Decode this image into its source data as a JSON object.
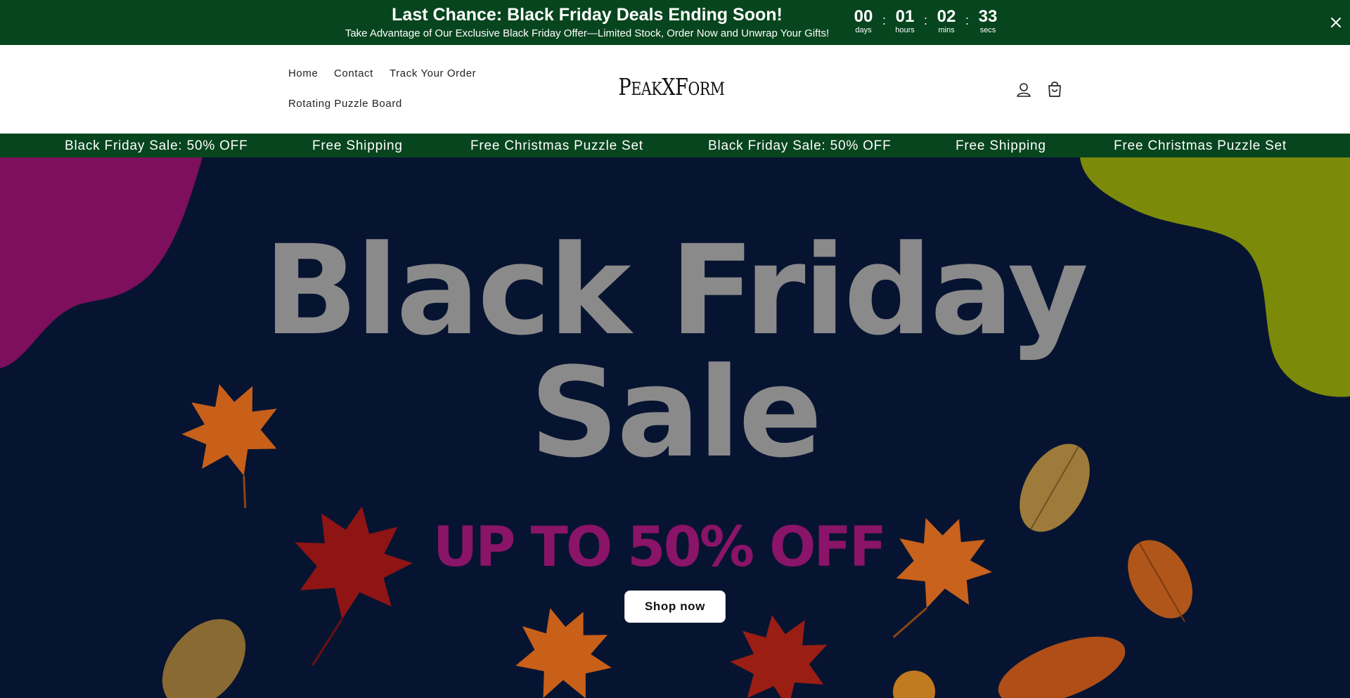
{
  "announcement": {
    "title": "Last Chance: Black Friday Deals Ending Soon!",
    "subtitle": "Take Advantage of Our Exclusive Black Friday Offer—Limited Stock, Order Now and Unwrap Your Gifts!",
    "countdown": [
      {
        "value": "00",
        "label": "days"
      },
      {
        "value": "01",
        "label": "hours"
      },
      {
        "value": "02",
        "label": "mins"
      },
      {
        "value": "33",
        "label": "secs"
      }
    ],
    "separator": ":",
    "close_icon": "close-icon"
  },
  "header": {
    "nav": [
      "Home",
      "Contact",
      "Track Your Order",
      "Rotating Puzzle Board"
    ],
    "logo": {
      "first_cap": "P",
      "first_rest": "EAK",
      "middle": "X",
      "last_cap": "F",
      "last_rest": "ORM"
    },
    "icons": [
      "account-icon",
      "cart-icon"
    ]
  },
  "marquee": {
    "items": [
      "Black Friday Sale: 50% OFF",
      "Free Shipping",
      "Free Christmas Puzzle Set",
      "Black Friday Sale: 50% OFF",
      "Free Shipping",
      "Free Christmas Puzzle Set"
    ]
  },
  "hero": {
    "line1": "Black Friday",
    "line2": "Sale",
    "offer": "UP TO 50% OFF",
    "cta": "Shop now"
  },
  "colors": {
    "brand_green": "#07451e",
    "hero_bg": "#071431",
    "offer_magenta": "#8a1468",
    "blob_magenta": "#7d0f5c",
    "blob_olive": "#7c8a0a"
  }
}
